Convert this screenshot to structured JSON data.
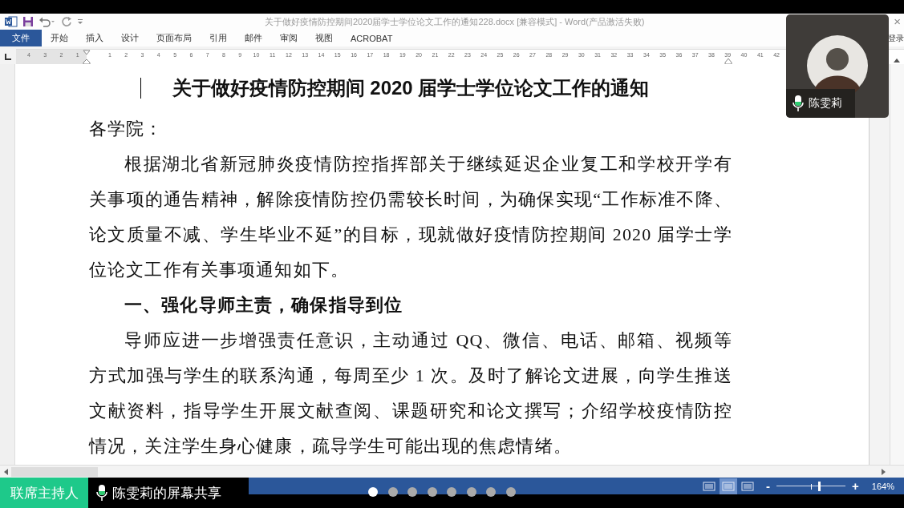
{
  "window": {
    "title": "关于做好疫情防控期间2020届学士学位论文工作的通知228.docx [兼容模式] - Word(产品激活失败)",
    "login": "登录",
    "close": "×"
  },
  "ribbon_tabs": [
    {
      "label": "文件",
      "selected": true
    },
    {
      "label": "开始",
      "selected": false
    },
    {
      "label": "插入",
      "selected": false
    },
    {
      "label": "设计",
      "selected": false
    },
    {
      "label": "页面布局",
      "selected": false
    },
    {
      "label": "引用",
      "selected": false
    },
    {
      "label": "邮件",
      "selected": false
    },
    {
      "label": "审阅",
      "selected": false
    },
    {
      "label": "视图",
      "selected": false
    },
    {
      "label": "ACROBAT",
      "selected": false
    }
  ],
  "ruler": {
    "left_labels": [
      "4",
      "3",
      "2",
      "1"
    ],
    "right_labels": [
      "1",
      "2",
      "3",
      "4",
      "5",
      "6",
      "7",
      "8",
      "9",
      "10",
      "11",
      "12",
      "13",
      "14",
      "15",
      "16",
      "17",
      "18",
      "19",
      "20",
      "21",
      "22",
      "23",
      "24",
      "25",
      "26",
      "27",
      "28",
      "29",
      "30",
      "31",
      "32",
      "33",
      "34",
      "35",
      "36",
      "37",
      "38",
      "39",
      "40",
      "41",
      "42"
    ]
  },
  "document": {
    "title": "关于做好疫情防控期间 2020 届学士学位论文工作的通知",
    "blocks": [
      {
        "kind": "salutation",
        "text": "各学院："
      },
      {
        "kind": "paragraph",
        "text": "根据湖北省新冠肺炎疫情防控指挥部关于继续延迟企业复工和学校开学有关事项的通告精神，解除疫情防控仍需较长时间，为确保实现“工作标准不降、论文质量不减、学生毕业不延”的目标，现就做好疫情防控期间 2020 届学士学位论文工作有关事项通知如下。"
      },
      {
        "kind": "heading",
        "text": "一、强化导师主责，确保指导到位"
      },
      {
        "kind": "paragraph",
        "text": "导师应进一步增强责任意识，主动通过 QQ、微信、电话、邮箱、视频等方式加强与学生的联系沟通，每周至少 1 次。及时了解论文进展，向学生推送文献资料，指导学生开展文献查阅、课题研究和论文撰写；介绍学校疫情防控情况，关注学生身心健康，疏导学生可能出现的焦虑情绪。"
      }
    ]
  },
  "status_bar": {
    "views": [
      {
        "selected": false
      },
      {
        "selected": true
      },
      {
        "selected": false
      }
    ],
    "zoom": {
      "level": 0.62,
      "reading": "164%",
      "minus": "-",
      "plus": "+"
    }
  },
  "meeting": {
    "participant": {
      "name": "陈雯莉"
    },
    "host_label": "联席主持人",
    "share_label": "陈雯莉的屏幕共享",
    "pages": [
      {
        "selected": true
      },
      {
        "selected": false
      },
      {
        "selected": false
      },
      {
        "selected": false
      },
      {
        "selected": false
      },
      {
        "selected": false
      },
      {
        "selected": false
      },
      {
        "selected": false
      }
    ]
  }
}
